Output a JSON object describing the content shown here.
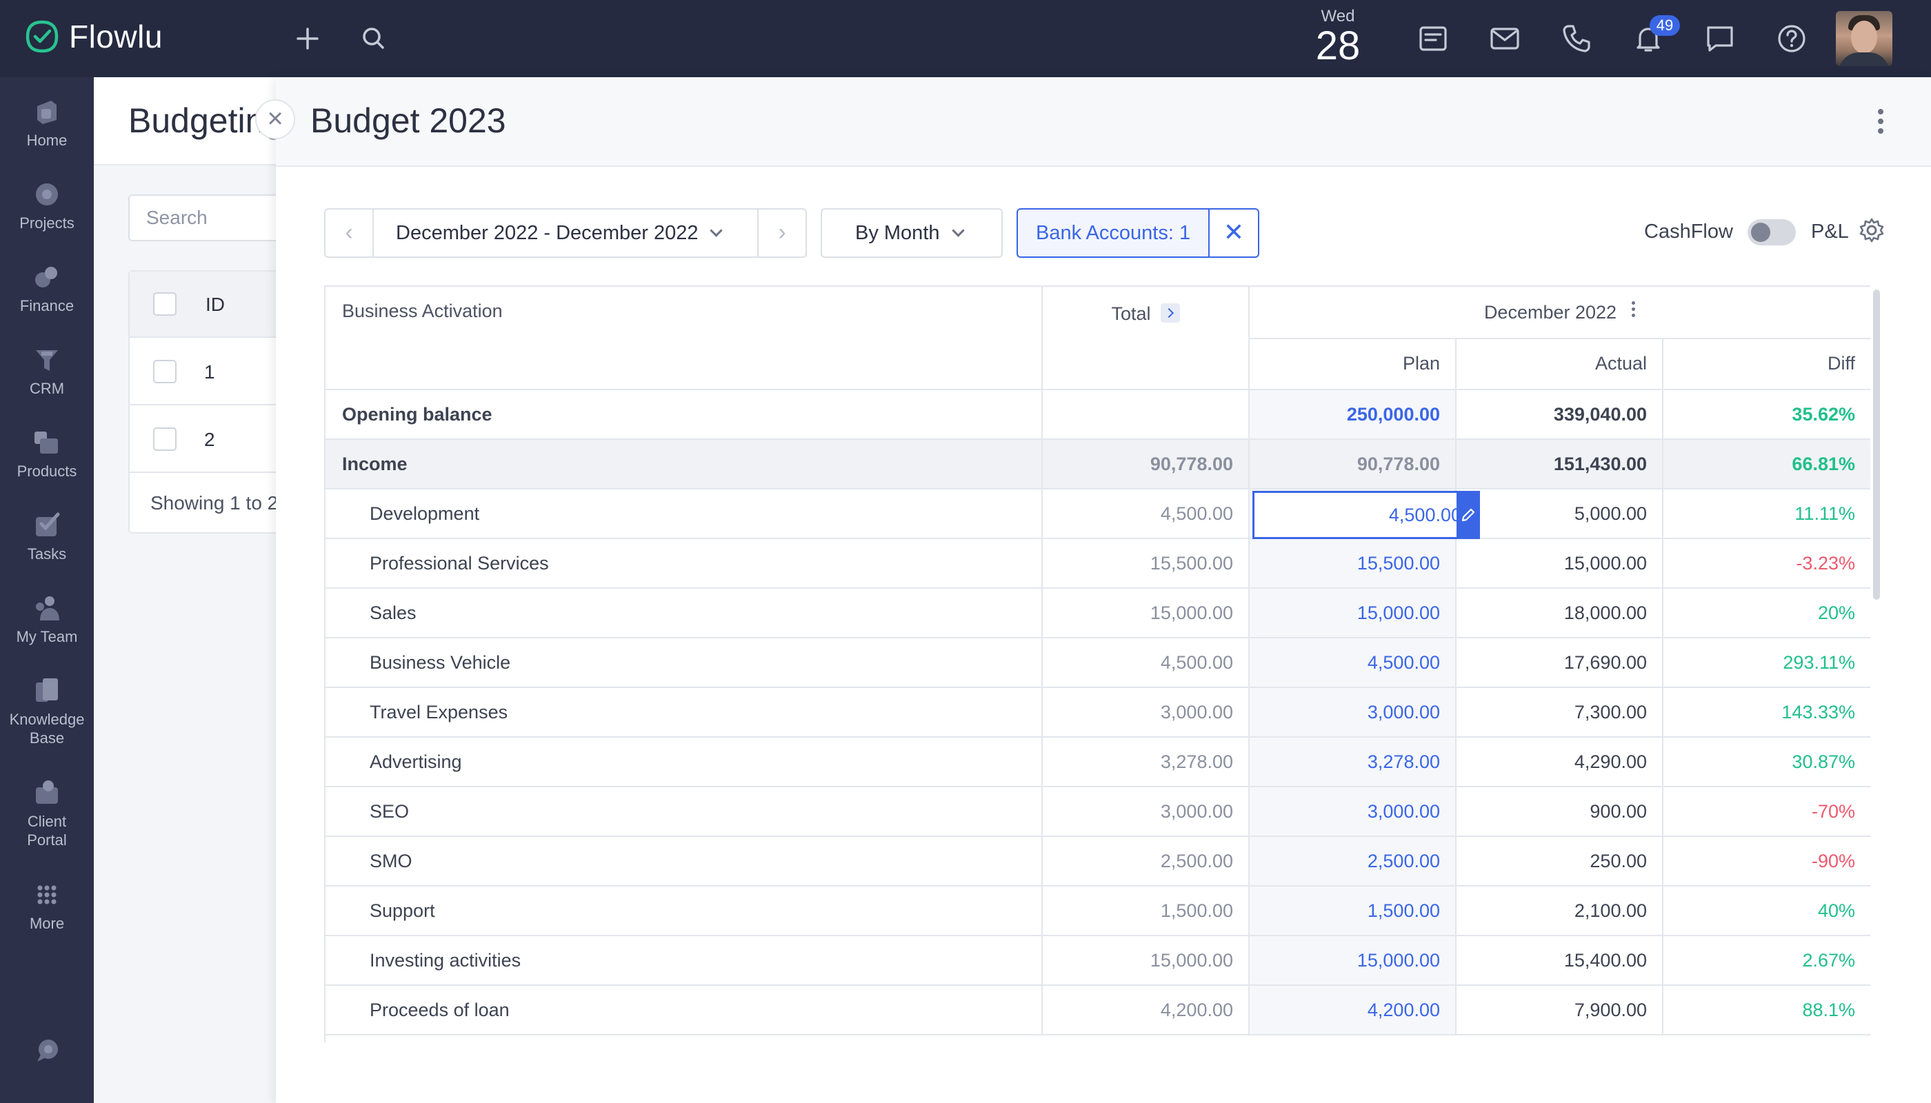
{
  "app": {
    "name": "Flowlu"
  },
  "topbar": {
    "date_dow": "Wed",
    "date_day": "28",
    "notifications_count": "49"
  },
  "sidebar": {
    "items": [
      {
        "label": "Home",
        "icon": "home-icon"
      },
      {
        "label": "Projects",
        "icon": "projects-icon"
      },
      {
        "label": "Finance",
        "icon": "finance-icon"
      },
      {
        "label": "CRM",
        "icon": "crm-icon"
      },
      {
        "label": "Products",
        "icon": "products-icon"
      },
      {
        "label": "Tasks",
        "icon": "tasks-icon"
      },
      {
        "label": "My Team",
        "icon": "team-icon"
      },
      {
        "label": "Knowledge",
        "label2": "Base",
        "icon": "knowledge-base-icon"
      },
      {
        "label": "Client",
        "label2": "Portal",
        "icon": "client-portal-icon"
      },
      {
        "label": "More",
        "icon": "more-grid-icon"
      }
    ]
  },
  "background_page": {
    "title": "Budgeting",
    "search_placeholder": "Search",
    "table": {
      "header": "ID",
      "rows": [
        "1",
        "2"
      ],
      "footer": "Showing 1 to 2"
    }
  },
  "panel": {
    "title": "Budget 2023",
    "date_range": "December 2022 - December 2022",
    "group_by": "By Month",
    "bank_accounts": "Bank Accounts: 1",
    "cashflow_label": "CashFlow",
    "pl_label": "P&L",
    "cashflow_enabled": false
  },
  "table": {
    "row_header": "Business Activation",
    "total_header": "Total",
    "month_header": "December 2022",
    "sub_headers": {
      "plan": "Plan",
      "actual": "Actual",
      "diff": "Diff"
    },
    "opening": {
      "label": "Opening balance",
      "total": "",
      "plan": "250,000.00",
      "actual": "339,040.00",
      "diff": "35.62%",
      "diff_sign": "pos"
    },
    "income": {
      "label": "Income",
      "total": "90,778.00",
      "plan": "90,778.00",
      "actual": "151,430.00",
      "diff": "66.81%",
      "diff_sign": "pos"
    },
    "rows": [
      {
        "label": "Development",
        "total": "4,500.00",
        "plan": "4,500.00",
        "actual": "5,000.00",
        "diff": "11.11%",
        "diff_sign": "pos"
      },
      {
        "label": "Professional Services",
        "total": "15,500.00",
        "plan": "15,500.00",
        "actual": "15,000.00",
        "diff": "-3.23%",
        "diff_sign": "neg"
      },
      {
        "label": "Sales",
        "total": "15,000.00",
        "plan": "15,000.00",
        "actual": "18,000.00",
        "diff": "20%",
        "diff_sign": "pos"
      },
      {
        "label": "Business Vehicle",
        "total": "4,500.00",
        "plan": "4,500.00",
        "actual": "17,690.00",
        "diff": "293.11%",
        "diff_sign": "pos"
      },
      {
        "label": "Travel Expenses",
        "total": "3,000.00",
        "plan": "3,000.00",
        "actual": "7,300.00",
        "diff": "143.33%",
        "diff_sign": "pos"
      },
      {
        "label": "Advertising",
        "total": "3,278.00",
        "plan": "3,278.00",
        "actual": "4,290.00",
        "diff": "30.87%",
        "diff_sign": "pos"
      },
      {
        "label": "SEO",
        "total": "3,000.00",
        "plan": "3,000.00",
        "actual": "900.00",
        "diff": "-70%",
        "diff_sign": "neg"
      },
      {
        "label": "SMO",
        "total": "2,500.00",
        "plan": "2,500.00",
        "actual": "250.00",
        "diff": "-90%",
        "diff_sign": "neg"
      },
      {
        "label": "Support",
        "total": "1,500.00",
        "plan": "1,500.00",
        "actual": "2,100.00",
        "diff": "40%",
        "diff_sign": "pos"
      },
      {
        "label": "Investing activities",
        "total": "15,000.00",
        "plan": "15,000.00",
        "actual": "15,400.00",
        "diff": "2.67%",
        "diff_sign": "pos"
      },
      {
        "label": "Proceeds of loan",
        "total": "4,200.00",
        "plan": "4,200.00",
        "actual": "7,900.00",
        "diff": "88.1%",
        "diff_sign": "pos"
      }
    ]
  },
  "colors": {
    "accent": "#3a66e6",
    "positive": "#22c08a",
    "negative": "#ee5a6e",
    "topbar": "#252a41",
    "sidebar": "#2c3149"
  }
}
